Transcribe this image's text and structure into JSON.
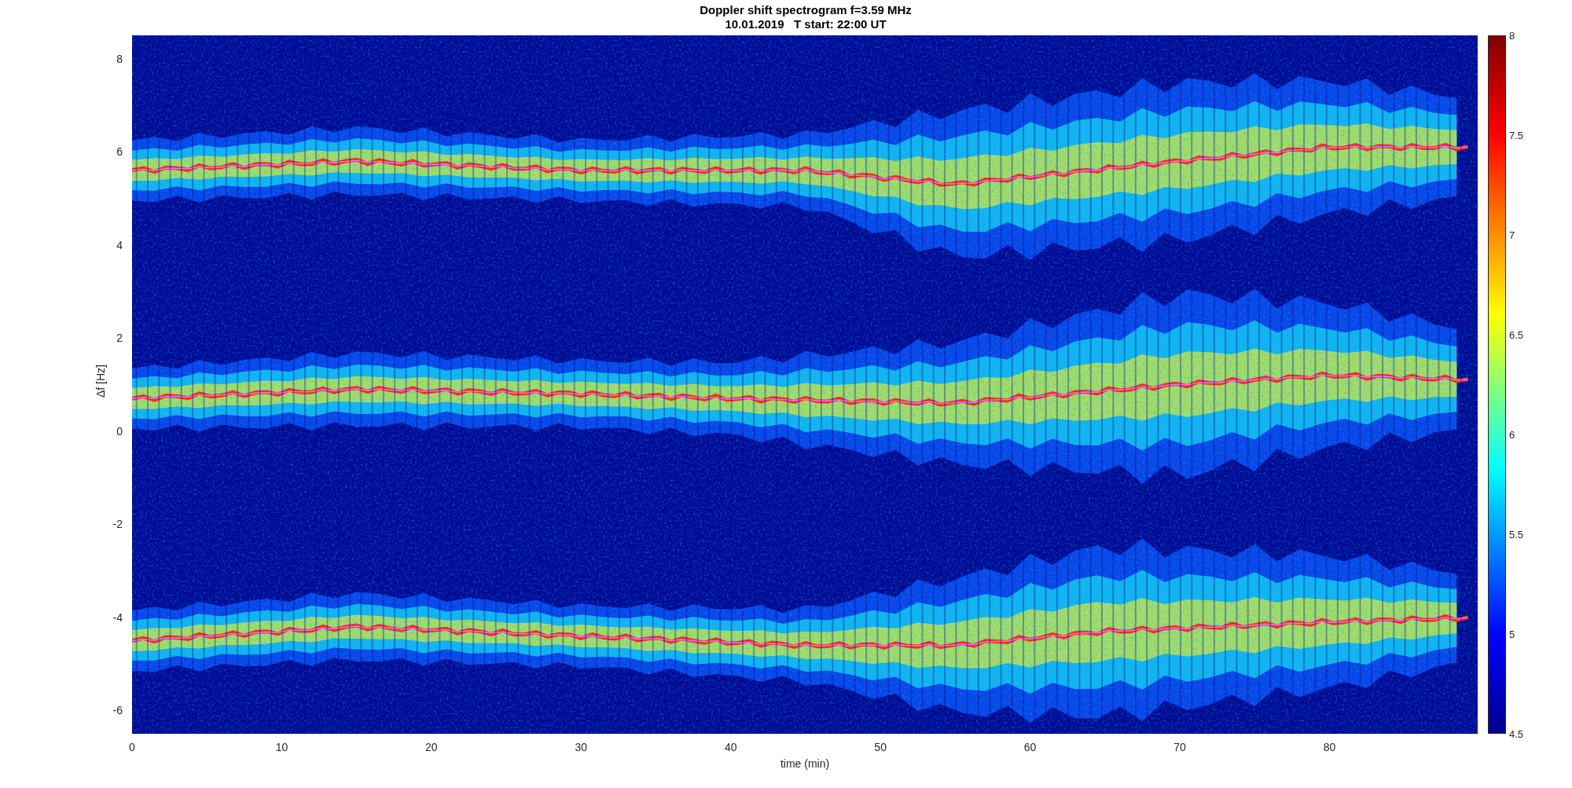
{
  "title": {
    "line_1": "Doppler shift spectrogram f=3.59 MHz",
    "line_2": "10.01.2019   T start: 22:00 UT"
  },
  "plot": {
    "xlabel": "time (min)",
    "ylabel": "Δf [Hz]",
    "x_ticks": [
      "0",
      "10",
      "20",
      "30",
      "40",
      "50",
      "60",
      "70",
      "80"
    ],
    "y_ticks": [
      "8",
      "6",
      "4",
      "2",
      "0",
      "-2",
      "-4",
      "-6"
    ]
  },
  "colorbar": {
    "ticks": [
      "8",
      "7.5",
      "7",
      "6.5",
      "6",
      "5.5",
      "5",
      "4.5"
    ]
  }
}
